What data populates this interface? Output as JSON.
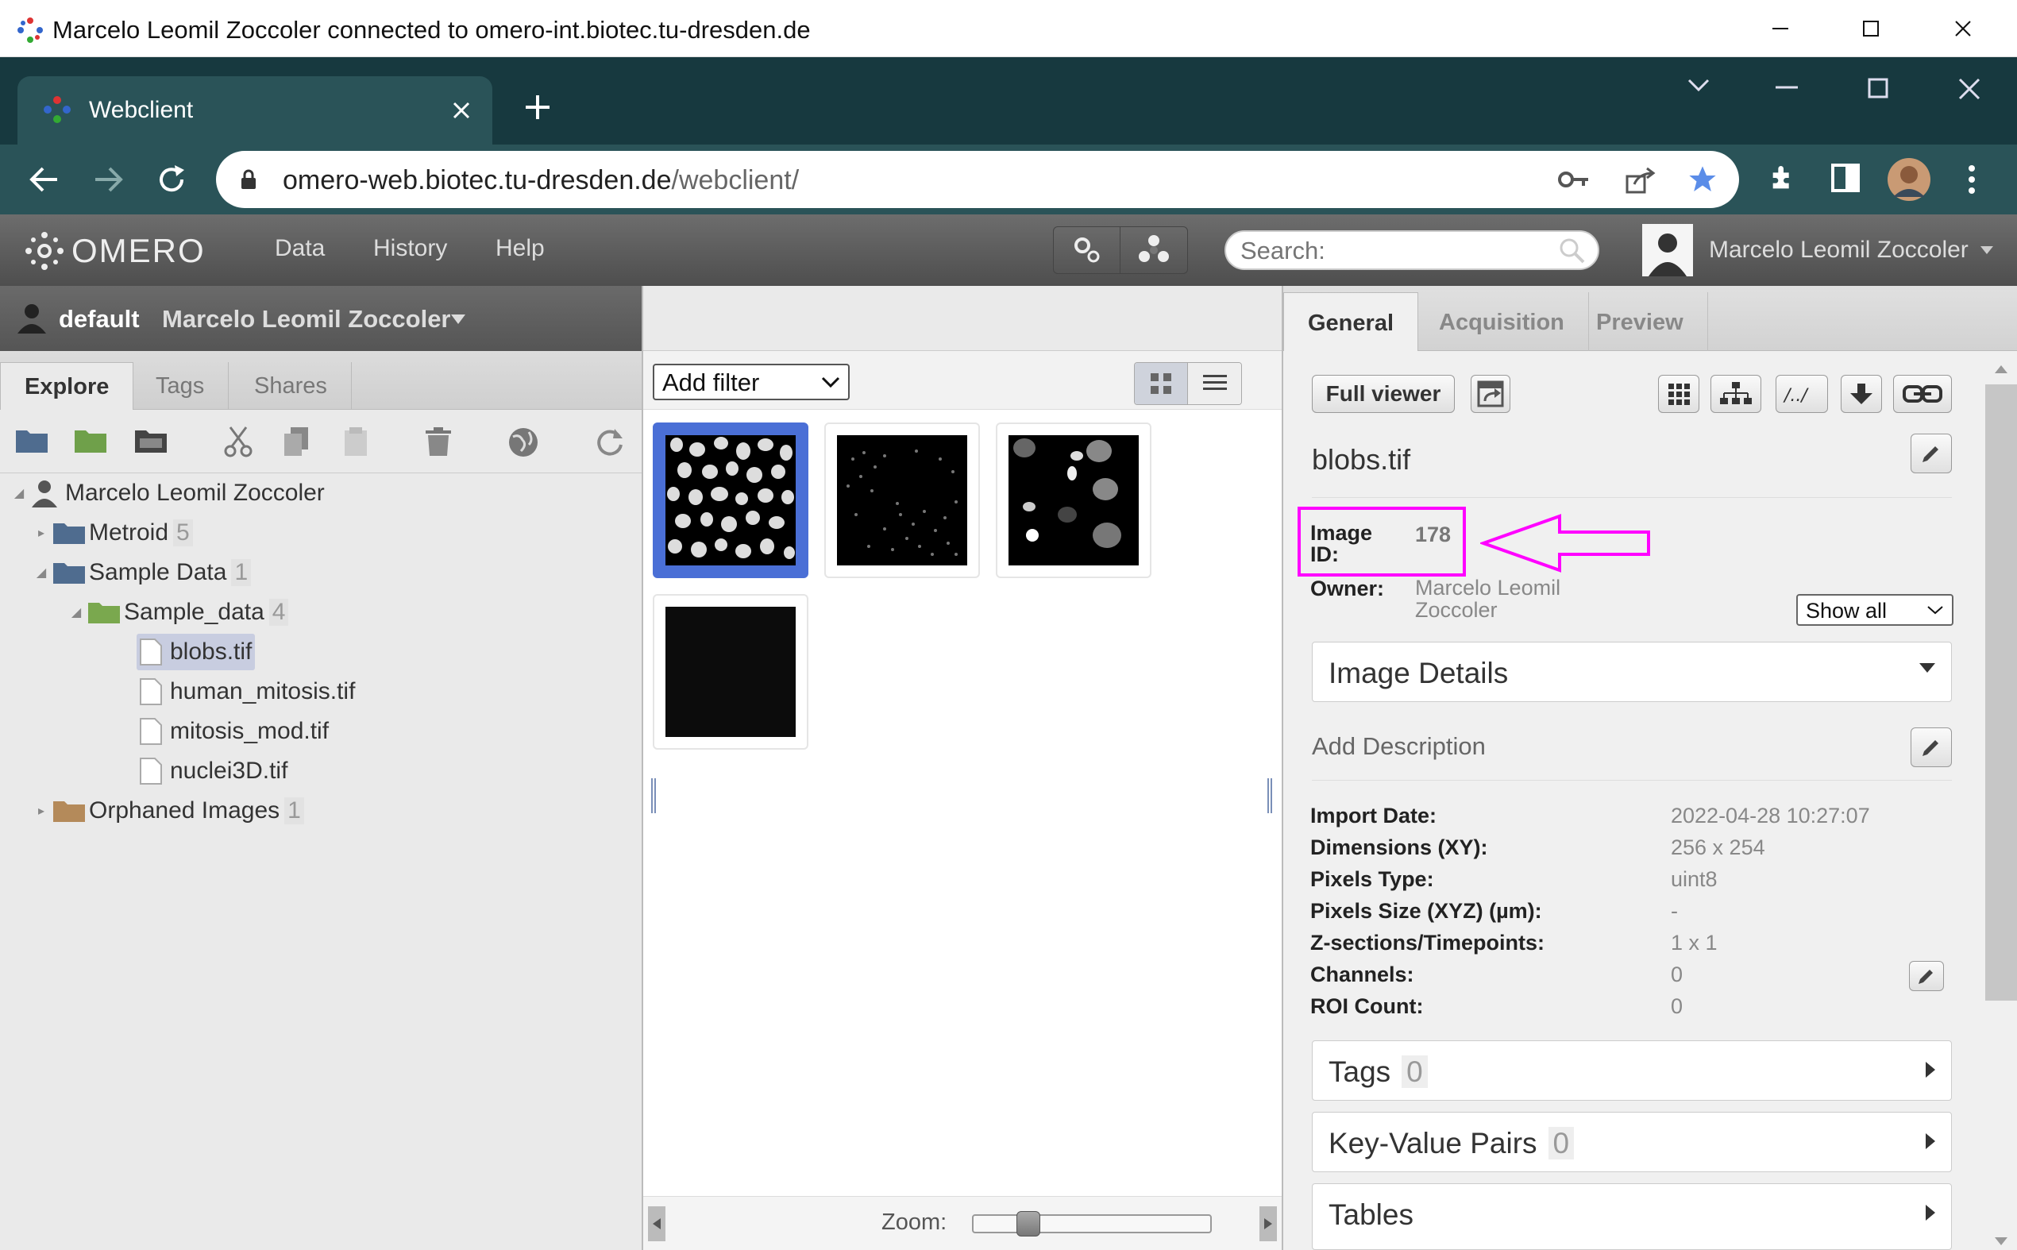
{
  "titlebar": {
    "title": "Marcelo Leomil Zoccoler connected to omero-int.biotec.tu-dresden.de"
  },
  "browser": {
    "tab_title": "Webclient",
    "url_host": "omero-web.biotec.tu-dresden.de",
    "url_path": "/webclient/"
  },
  "header": {
    "logo": "OMERO",
    "nav": [
      "Data",
      "History",
      "Help"
    ],
    "search_placeholder": "Search:",
    "user_name": "Marcelo Leomil Zoccoler"
  },
  "left": {
    "group": "default",
    "user": "Marcelo Leomil Zoccoler",
    "tabs": [
      "Explore",
      "Tags",
      "Shares"
    ],
    "tree": {
      "root": "Marcelo Leomil Zoccoler",
      "nodes": [
        {
          "label": "Metroid",
          "count": "5"
        },
        {
          "label": "Sample Data",
          "count": "1"
        },
        {
          "label": "Sample_data",
          "count": "4"
        },
        {
          "label": "blobs.tif"
        },
        {
          "label": "human_mitosis.tif"
        },
        {
          "label": "mitosis_mod.tif"
        },
        {
          "label": "nuclei3D.tif"
        },
        {
          "label": "Orphaned Images",
          "count": "1"
        }
      ]
    }
  },
  "center": {
    "filter_label": "Add filter",
    "zoom_label": "Zoom:",
    "zoom_level": 0.2
  },
  "right": {
    "tabs": [
      "General",
      "Acquisition",
      "Preview"
    ],
    "full_viewer": "Full viewer",
    "image_name": "blobs.tif",
    "image_id_label": "Image ID:",
    "image_id": "178",
    "owner_label": "Owner:",
    "owner": "Marcelo Leomil Zoccoler",
    "show_all": "Show all",
    "image_details": "Image Details",
    "add_description": "Add Description",
    "metadata": [
      {
        "label": "Import Date:",
        "value": "2022-04-28 10:27:07"
      },
      {
        "label": "Dimensions (XY):",
        "value": "256 x 254"
      },
      {
        "label": "Pixels Type:",
        "value": "uint8"
      },
      {
        "label": "Pixels Size (XYZ) (µm):",
        "value": "-"
      },
      {
        "label": "Z-sections/Timepoints:",
        "value": "1 x 1"
      },
      {
        "label": "Channels:",
        "value": "0"
      },
      {
        "label": "ROI Count:",
        "value": "0"
      }
    ],
    "accordions": [
      {
        "label": "Tags",
        "badge": "0"
      },
      {
        "label": "Key-Value Pairs",
        "badge": "0"
      },
      {
        "label": "Tables"
      }
    ]
  },
  "colors": {
    "highlight": "#ff00ff",
    "selection": "#4a6fd6",
    "chrome_dark": "#17393f",
    "chrome_mid": "#2a5358"
  }
}
